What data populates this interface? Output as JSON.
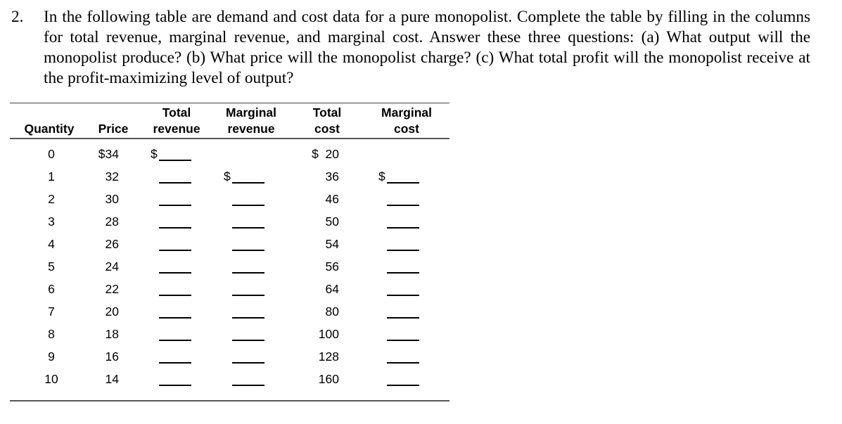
{
  "question": {
    "number": "2.",
    "text": "In the following table are demand and cost data for a pure monopolist.  Complete the table by filling in the columns for total revenue, marginal revenue, and marginal cost.  Answer these three questions:  (a) What output will the monopolist produce?  (b) What price will the monopolist charge?  (c) What total profit will the monopolist receive at the profit-maximizing level of output?"
  },
  "table": {
    "headers": {
      "quantity": [
        "",
        "Quantity"
      ],
      "price": [
        "",
        "Price"
      ],
      "total_revenue": [
        "Total",
        "revenue"
      ],
      "marginal_revenue": [
        "Marginal",
        "revenue"
      ],
      "total_cost": [
        "Total",
        "cost"
      ],
      "marginal_cost": [
        "Marginal",
        "cost"
      ]
    },
    "currency_symbol": "$",
    "blank": "_____",
    "rows": [
      {
        "quantity": "0",
        "price": "$34",
        "total_cost": "$  20"
      },
      {
        "quantity": "1",
        "price": "32",
        "total_cost": "36"
      },
      {
        "quantity": "2",
        "price": "30",
        "total_cost": "46"
      },
      {
        "quantity": "3",
        "price": "28",
        "total_cost": "50"
      },
      {
        "quantity": "4",
        "price": "26",
        "total_cost": "54"
      },
      {
        "quantity": "5",
        "price": "24",
        "total_cost": "56"
      },
      {
        "quantity": "6",
        "price": "22",
        "total_cost": "64"
      },
      {
        "quantity": "7",
        "price": "20",
        "total_cost": "80"
      },
      {
        "quantity": "8",
        "price": "18",
        "total_cost": "100"
      },
      {
        "quantity": "9",
        "price": "16",
        "total_cost": "128"
      },
      {
        "quantity": "10",
        "price": "14",
        "total_cost": "160"
      }
    ]
  }
}
